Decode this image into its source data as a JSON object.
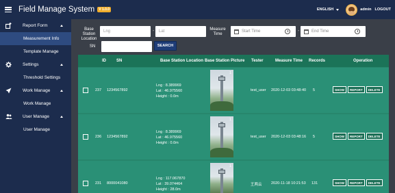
{
  "header": {
    "title": "Field Manage System",
    "version": "V 1.0.0",
    "language": "ENGLISH",
    "user": "admin",
    "logout": "LOGOUT"
  },
  "sidebar": {
    "groups": [
      {
        "label": "Report Form",
        "icon": "report-icon",
        "items": [
          "Measurement Info",
          "Template Manage"
        ]
      },
      {
        "label": "Settings",
        "icon": "gear-icon",
        "items": [
          "Threshold Settings"
        ]
      },
      {
        "label": "Work Manage",
        "icon": "send-icon",
        "items": [
          "Work Manage"
        ]
      },
      {
        "label": "User Manage",
        "icon": "users-icon",
        "items": [
          "User Manage"
        ]
      }
    ],
    "active_item": "Measurement Info"
  },
  "filters": {
    "base_station_location_label": "Base Station Location",
    "lng_placeholder": "Lng",
    "lat_placeholder": "Lat",
    "measure_time_label": "Measure Time",
    "start_time_placeholder": "Start Time",
    "end_time_placeholder": "End Time",
    "sn_label": "SN",
    "sn_value": "",
    "search_label": "SEARCH"
  },
  "table": {
    "columns": [
      "ID",
      "SN",
      "Base Station Location",
      "Base Station Picture",
      "Tester",
      "Measure Time",
      "Records",
      "Operation"
    ],
    "rows": [
      {
        "id": "237",
        "sn": "1234567892",
        "lng": "Lng : 8.389969",
        "lat": "Lat : 46.975560",
        "height": "Height : 0.0m",
        "pic_count": "1",
        "tester": "test_user",
        "time": "2020-12-03 03:48:40",
        "records": "5"
      },
      {
        "id": "236",
        "sn": "1234567892",
        "lng": "Lng : 8.389969",
        "lat": "Lat : 46.975560",
        "height": "Height : 0.0m",
        "pic_count": "1",
        "tester": "test_user",
        "time": "2020-12-03 03:48:16",
        "records": "5"
      },
      {
        "id": "231",
        "sn": "8000041080",
        "lng": "Lng : 117.067870",
        "lat": "Lat : 39.074464",
        "height": "Height : 28.0m",
        "pic_count": "1",
        "tester": "王两云",
        "time": "2020-11-18 10:21:53",
        "records": "131"
      }
    ],
    "ops": {
      "show": "SHOW",
      "report": "REPORT",
      "delete": "DELETE"
    }
  }
}
